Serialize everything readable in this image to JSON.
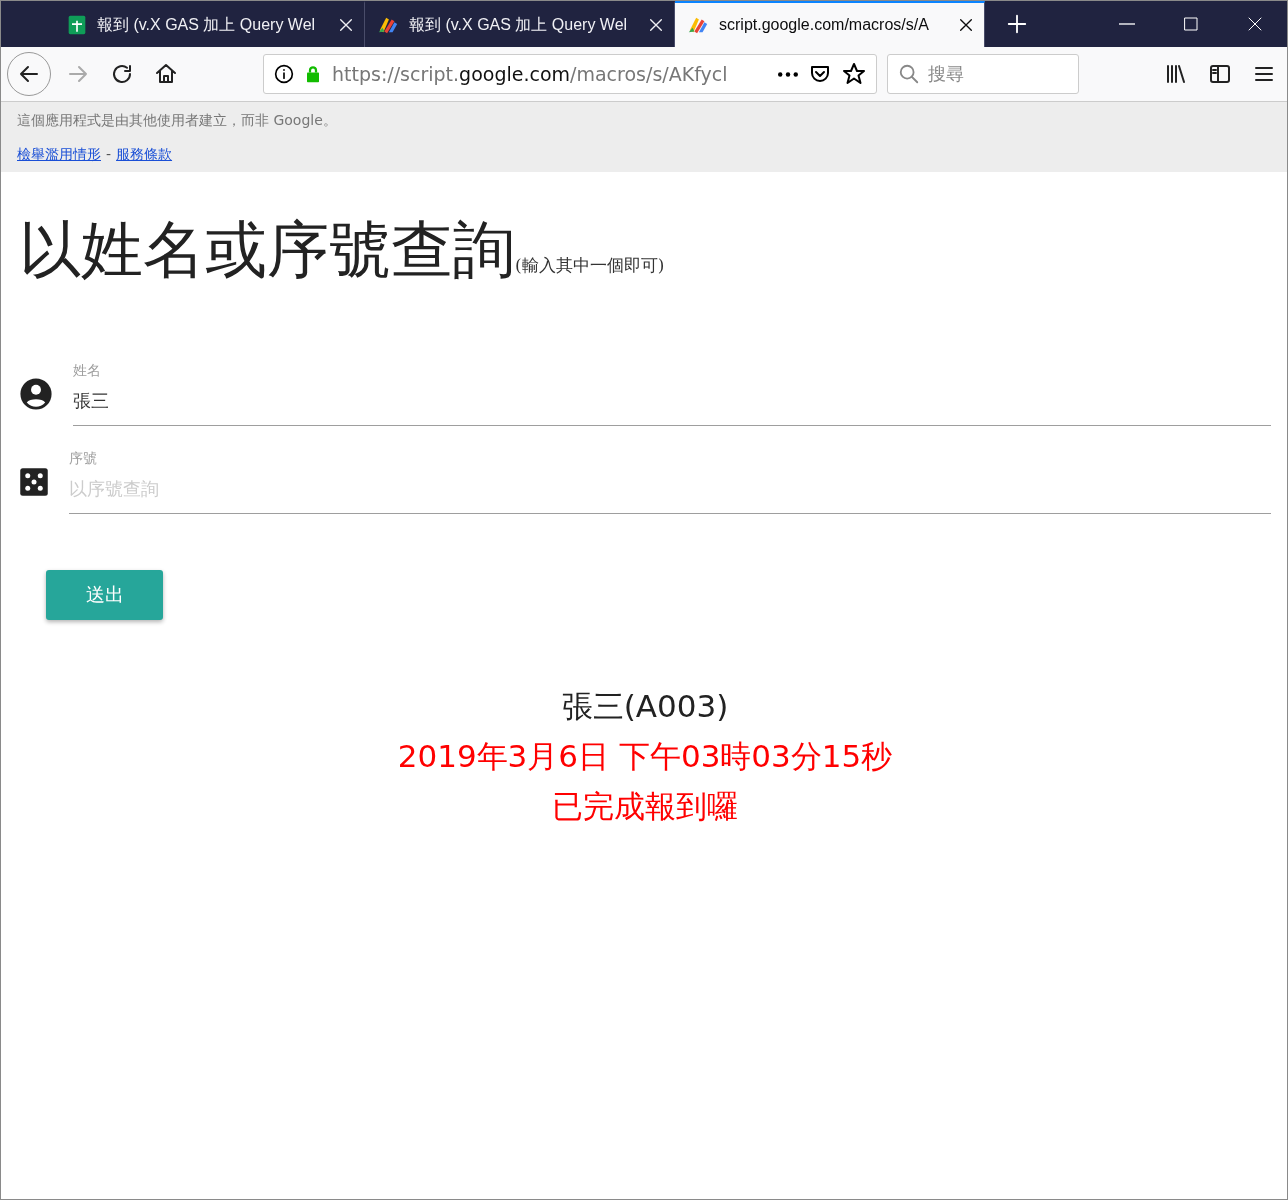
{
  "browser": {
    "tabs": [
      {
        "kind": "sheets",
        "title": "報到 (v.X GAS 加上 Query Wel",
        "selected": false
      },
      {
        "kind": "script",
        "title": "報到 (v.X GAS 加上 Query Wel",
        "selected": false
      },
      {
        "kind": "script",
        "title": "script.google.com/macros/s/A",
        "selected": true
      }
    ],
    "address": [
      {
        "text": "https://script.",
        "strong": false
      },
      {
        "text": "google.com",
        "strong": true
      },
      {
        "text": "/macros/s/AKfycl",
        "strong": false
      }
    ],
    "search": {
      "placeholder": "搜尋"
    }
  },
  "banner": {
    "notice": "這個應用程式是由其他使用者建立，而非 Google。",
    "links": [
      "檢舉濫用情形",
      "服務條款"
    ],
    "separator": "-"
  },
  "heading": {
    "title": "以姓名或序號查詢",
    "hint": "(輸入其中一個即可)"
  },
  "fields": [
    {
      "kind": "person",
      "label": "姓名",
      "value": "張三"
    },
    {
      "kind": "dice",
      "label": "序號",
      "placeholder": "以序號查詢"
    }
  ],
  "submit": "送出",
  "result": [
    {
      "kind": "name",
      "text": "張三(A003)"
    },
    {
      "kind": "alert",
      "text": "2019年3月6日 下午03時03分15秒"
    },
    {
      "kind": "alert",
      "text": "已完成報到囉"
    }
  ]
}
